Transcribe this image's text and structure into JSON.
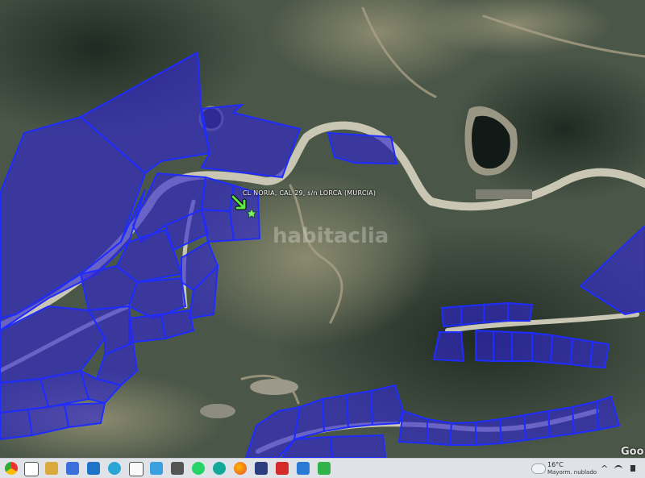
{
  "map": {
    "property_label": "CL NORIA, CAL 29, s/n LORCA (MURCIA)",
    "watermark": "habitaclia",
    "attribution": "Goo",
    "marker_icon": "green-arrow-pin-icon",
    "colors": {
      "parcel_fill": "#3026d2",
      "parcel_stroke": "#1f2cff",
      "marker": "#5ee842"
    }
  },
  "taskbar": {
    "weather": {
      "temperature": "16°C",
      "description": "Mayorm. nublado"
    },
    "icons": [
      "chrome-icon",
      "taskview-icon",
      "file-explorer-icon",
      "store-icon",
      "edge-icon",
      "files-icon",
      "media-icon",
      "network-icon",
      "whatsapp-icon",
      "meet-icon",
      "firefox-icon",
      "app-icon",
      "acrobat-icon",
      "sapp-icon",
      "green-app-icon"
    ],
    "tray": {
      "chevron": "^",
      "network_icon": "wifi-icon",
      "volume_icon": "speaker-icon"
    }
  }
}
